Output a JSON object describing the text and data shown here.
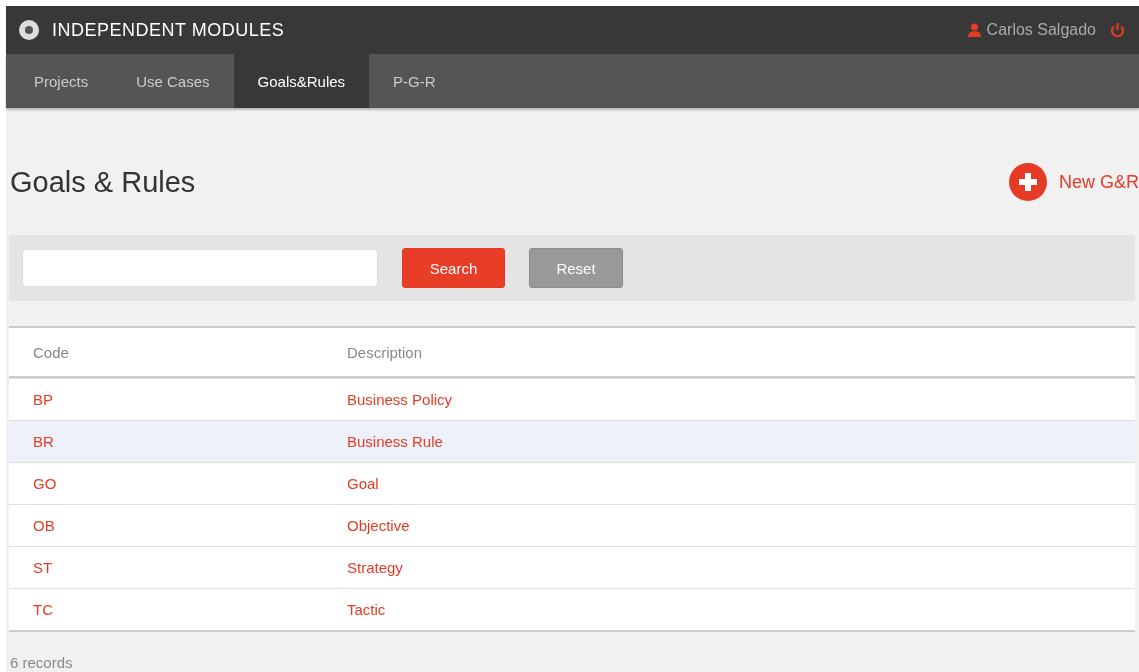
{
  "app": {
    "title": "INDEPENDENT MODULES",
    "user": "Carlos Salgado"
  },
  "tabs": [
    {
      "label": "Projects",
      "selected": false
    },
    {
      "label": "Use Cases",
      "selected": false
    },
    {
      "label": "Goals&Rules",
      "selected": true
    },
    {
      "label": "P-G-R",
      "selected": false
    }
  ],
  "page": {
    "title": "Goals & Rules",
    "new_button": "New G&R"
  },
  "search": {
    "button": "Search",
    "reset": "Reset"
  },
  "table": {
    "columns": [
      "Code",
      "Description"
    ],
    "rows": [
      {
        "code": "BP",
        "description": "Business Policy",
        "highlighted": false
      },
      {
        "code": "BR",
        "description": "Business Rule",
        "highlighted": true
      },
      {
        "code": "GO",
        "description": "Goal",
        "highlighted": false
      },
      {
        "code": "OB",
        "description": "Objective",
        "highlighted": false
      },
      {
        "code": "ST",
        "description": "Strategy",
        "highlighted": false
      },
      {
        "code": "TC",
        "description": "Tactic",
        "highlighted": false
      }
    ]
  },
  "footer": "6 records"
}
